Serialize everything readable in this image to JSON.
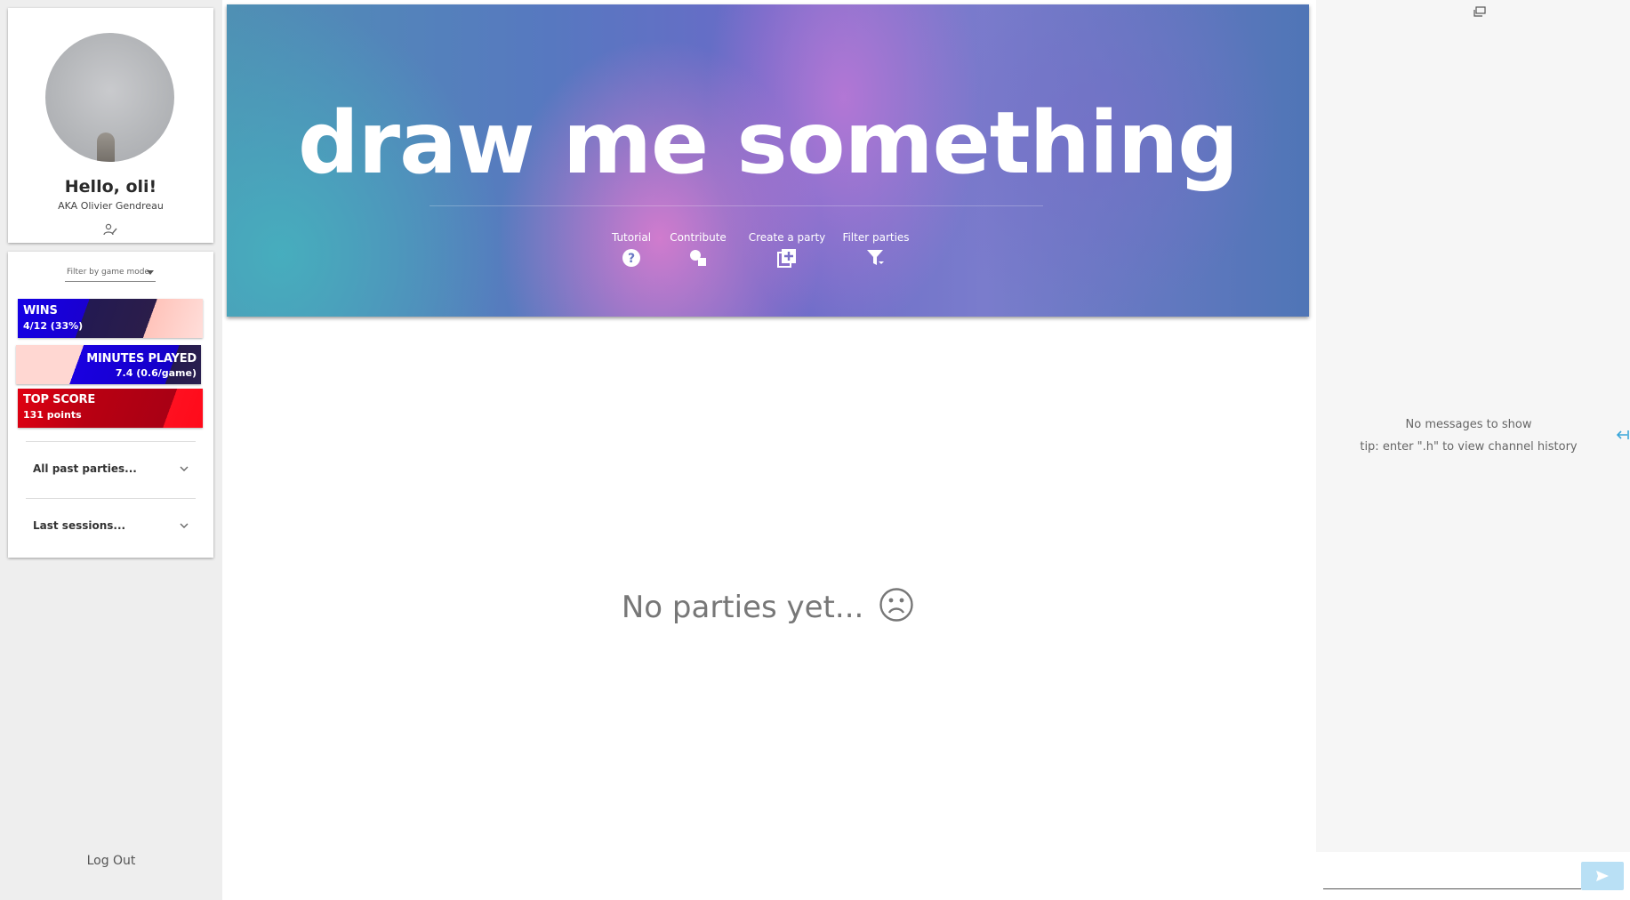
{
  "profile": {
    "greeting": "Hello, oli!",
    "aka": "AKA Olivier Gendreau"
  },
  "stats": {
    "filter_placeholder": "Filter by game mode",
    "wins": {
      "label": "WINS",
      "value": "4/12 (33%)"
    },
    "minutes": {
      "label": "MINUTES PLAYED",
      "value": "7.4 (0.6/game)"
    },
    "top_score": {
      "label": "TOP SCORE",
      "value": "131 points"
    },
    "past_parties": "All past parties...",
    "last_sessions": "Last sessions..."
  },
  "logout_label": "Log Out",
  "banner": {
    "title": "draw me something",
    "actions": [
      {
        "label": "Tutorial",
        "icon": "help-circle-icon"
      },
      {
        "label": "Contribute",
        "icon": "shapes-icon"
      },
      {
        "label": "Create a party",
        "icon": "library-add-icon"
      },
      {
        "label": "Filter parties",
        "icon": "filter-icon"
      }
    ]
  },
  "main": {
    "empty_text": "No parties yet...",
    "empty_icon": "sad-face-icon"
  },
  "chat": {
    "empty_text": "No messages to show",
    "tip": "tip: enter \".h\" to view channel history",
    "input_value": ""
  },
  "colors": {
    "wins_primary": "#1400e6",
    "top_score_primary": "#b80012",
    "send_button": "#b9e0f5",
    "sidebar_bg": "#eeeeee"
  }
}
